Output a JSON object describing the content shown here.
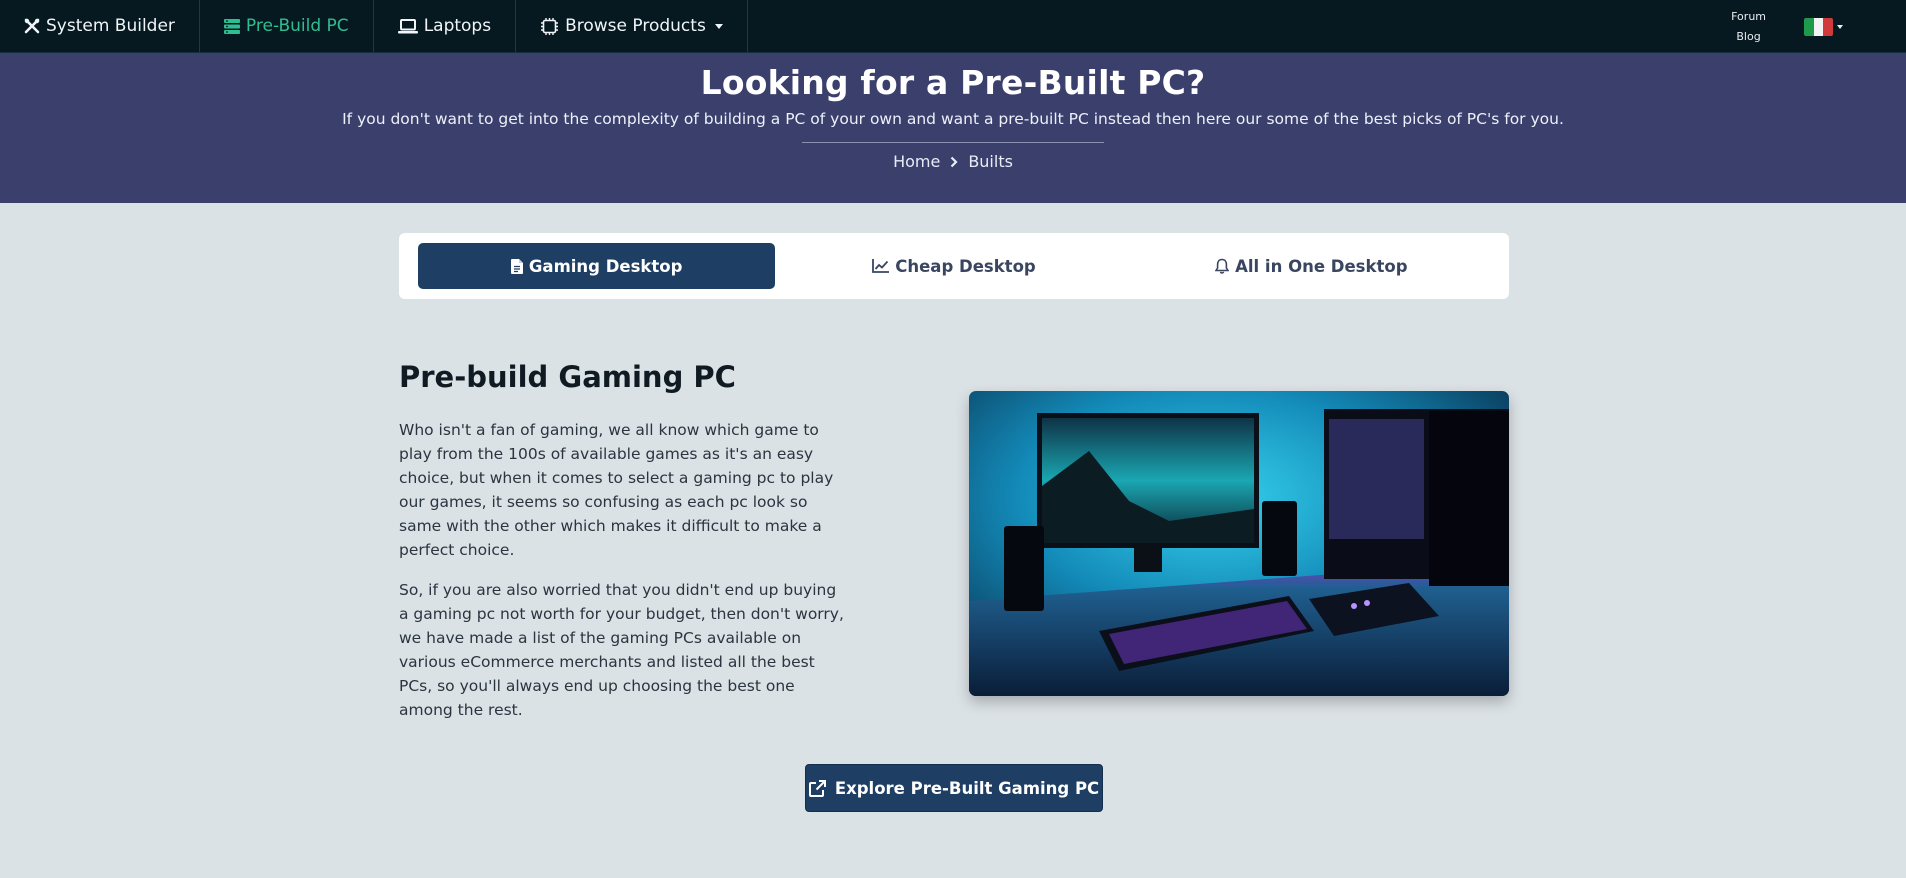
{
  "nav": {
    "items": [
      {
        "label": "System Builder",
        "icon": "tools-icon",
        "active": false
      },
      {
        "label": "Pre-Build PC",
        "icon": "server-icon",
        "active": true
      },
      {
        "label": "Laptops",
        "icon": "laptop-icon",
        "active": false
      },
      {
        "label": "Browse Products",
        "icon": "chip-icon",
        "active": false,
        "dropdown": true
      }
    ],
    "forum_label": "Forum",
    "blog_label": "Blog",
    "language_flag": "italy-flag-icon"
  },
  "hero": {
    "title": "Looking for a Pre-Built PC?",
    "subtitle": "If you don't want to get into the complexity of building a PC of your own and want a pre-built PC instead then here our some of the best picks of PC's for you.",
    "breadcrumb": {
      "home": "Home",
      "current": "Builts"
    }
  },
  "tabs": [
    {
      "label": "Gaming Desktop",
      "icon": "document-icon",
      "active": true
    },
    {
      "label": "Cheap Desktop",
      "icon": "chart-line-icon",
      "active": false
    },
    {
      "label": "All in One Desktop",
      "icon": "bell-icon",
      "active": false
    }
  ],
  "content": {
    "title": "Pre-build Gaming PC",
    "paragraph1": "Who isn't a fan of gaming, we all know which game to play from the 100s of available games as it's an easy choice, but when it comes to select a gaming pc to play our games, it seems so confusing as each pc look so same with the other which makes it difficult to make a perfect choice.",
    "paragraph2": "So, if you are also worried that you didn't end up buying a gaming pc not worth for your budget, then don't worry, we have made a list of the gaming PCs available on various eCommerce merchants and listed all the best PCs, so you'll always end up choosing the best one among the rest.",
    "cta_label": "Explore Pre-Built Gaming PC"
  },
  "colors": {
    "nav_bg": "#061820",
    "nav_active": "#2ebf91",
    "hero_bg": "#3a3f6c",
    "page_bg": "#dbe2e6",
    "primary": "#1e3e63"
  }
}
